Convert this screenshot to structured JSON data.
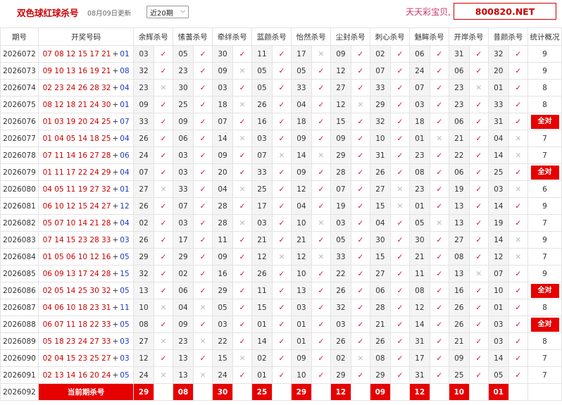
{
  "header": {
    "title": "双色球红球杀号",
    "updated": "08月09日更新",
    "period_select": "近20期",
    "slogan": "天天彩宝贝,",
    "site": "800820.NET"
  },
  "columns": [
    "期号",
    "开奖号码",
    "余辉杀号",
    "愫蓍杀号",
    "牵绊杀号",
    "蓝颜杀号",
    "怡然杀号",
    "尘封杀号",
    "刺心杀号",
    "魅眸杀号",
    "开岸杀号",
    "昔颜杀号",
    "统计概况"
  ],
  "all_right_label": "全对",
  "rows": [
    {
      "period": "2026072",
      "red": "07 08 12 15 17 21",
      "blue": "01",
      "kills": [
        [
          "03",
          "ok"
        ],
        [
          "05",
          "ok"
        ],
        [
          "30",
          "ok"
        ],
        [
          "11",
          "ok"
        ],
        [
          "17",
          "bad"
        ],
        [
          "09",
          "ok"
        ],
        [
          "02",
          "ok"
        ],
        [
          "06",
          "ok"
        ],
        [
          "31",
          "ok"
        ],
        [
          "32",
          "ok"
        ]
      ],
      "count": "9"
    },
    {
      "period": "2026073",
      "red": "09 10 13 16 19 21",
      "blue": "08",
      "kills": [
        [
          "32",
          "ok"
        ],
        [
          "23",
          "ok"
        ],
        [
          "09",
          "bad"
        ],
        [
          "05",
          "ok"
        ],
        [
          "05",
          "ok"
        ],
        [
          "12",
          "ok"
        ],
        [
          "07",
          "ok"
        ],
        [
          "24",
          "ok"
        ],
        [
          "06",
          "ok"
        ],
        [
          "20",
          "ok"
        ]
      ],
      "count": "9"
    },
    {
      "period": "2026074",
      "red": "02 23 24 26 28 32",
      "blue": "04",
      "kills": [
        [
          "23",
          "bad"
        ],
        [
          "30",
          "ok"
        ],
        [
          "03",
          "ok"
        ],
        [
          "05",
          "ok"
        ],
        [
          "33",
          "ok"
        ],
        [
          "27",
          "ok"
        ],
        [
          "33",
          "ok"
        ],
        [
          "07",
          "ok"
        ],
        [
          "23",
          "bad"
        ],
        [
          "01",
          "ok"
        ]
      ],
      "count": "8"
    },
    {
      "period": "2026075",
      "red": "08 12 18 21 24 30",
      "blue": "01",
      "kills": [
        [
          "09",
          "ok"
        ],
        [
          "25",
          "ok"
        ],
        [
          "18",
          "bad"
        ],
        [
          "26",
          "ok"
        ],
        [
          "04",
          "ok"
        ],
        [
          "12",
          "bad"
        ],
        [
          "29",
          "ok"
        ],
        [
          "03",
          "ok"
        ],
        [
          "23",
          "ok"
        ],
        [
          "33",
          "ok"
        ]
      ],
      "count": "8"
    },
    {
      "period": "2026076",
      "red": "01 03 19 20 24 25",
      "blue": "07",
      "kills": [
        [
          "33",
          "ok"
        ],
        [
          "09",
          "ok"
        ],
        [
          "07",
          "ok"
        ],
        [
          "16",
          "ok"
        ],
        [
          "18",
          "ok"
        ],
        [
          "15",
          "ok"
        ],
        [
          "32",
          "ok"
        ],
        [
          "18",
          "ok"
        ],
        [
          "06",
          "ok"
        ],
        [
          "31",
          "ok"
        ]
      ],
      "count": "全对"
    },
    {
      "period": "2026077",
      "red": "01 04 05 14 18 25",
      "blue": "04",
      "kills": [
        [
          "26",
          "ok"
        ],
        [
          "06",
          "ok"
        ],
        [
          "14",
          "bad"
        ],
        [
          "03",
          "ok"
        ],
        [
          "09",
          "ok"
        ],
        [
          "09",
          "ok"
        ],
        [
          "10",
          "ok"
        ],
        [
          "01",
          "bad"
        ],
        [
          "21",
          "ok"
        ],
        [
          "04",
          "bad"
        ]
      ],
      "count": "7"
    },
    {
      "period": "2026078",
      "red": "07 11 14 16 27 28",
      "blue": "06",
      "kills": [
        [
          "24",
          "ok"
        ],
        [
          "03",
          "ok"
        ],
        [
          "09",
          "ok"
        ],
        [
          "07",
          "bad"
        ],
        [
          "14",
          "bad"
        ],
        [
          "29",
          "ok"
        ],
        [
          "31",
          "ok"
        ],
        [
          "23",
          "ok"
        ],
        [
          "22",
          "ok"
        ],
        [
          "14",
          "bad"
        ]
      ],
      "count": "7"
    },
    {
      "period": "2026079",
      "red": "01 11 17 22 24 29",
      "blue": "04",
      "kills": [
        [
          "07",
          "ok"
        ],
        [
          "03",
          "ok"
        ],
        [
          "20",
          "ok"
        ],
        [
          "33",
          "ok"
        ],
        [
          "09",
          "ok"
        ],
        [
          "28",
          "ok"
        ],
        [
          "26",
          "ok"
        ],
        [
          "08",
          "ok"
        ],
        [
          "06",
          "ok"
        ],
        [
          "25",
          "ok"
        ]
      ],
      "count": "全对"
    },
    {
      "period": "2026080",
      "red": "04 05 11 19 27 32",
      "blue": "01",
      "kills": [
        [
          "27",
          "bad"
        ],
        [
          "33",
          "ok"
        ],
        [
          "04",
          "bad"
        ],
        [
          "25",
          "ok"
        ],
        [
          "12",
          "ok"
        ],
        [
          "07",
          "ok"
        ],
        [
          "27",
          "bad"
        ],
        [
          "23",
          "ok"
        ],
        [
          "19",
          "ok"
        ],
        [
          "03",
          "bad"
        ]
      ],
      "count": "6"
    },
    {
      "period": "2026081",
      "red": "06 10 12 15 24 27",
      "blue": "12",
      "kills": [
        [
          "26",
          "ok"
        ],
        [
          "07",
          "ok"
        ],
        [
          "28",
          "ok"
        ],
        [
          "17",
          "ok"
        ],
        [
          "04",
          "ok"
        ],
        [
          "19",
          "ok"
        ],
        [
          "15",
          "bad"
        ],
        [
          "01",
          "ok"
        ],
        [
          "13",
          "ok"
        ],
        [
          "14",
          "ok"
        ]
      ],
      "count": "9"
    },
    {
      "period": "2026082",
      "red": "05 07 10 14 21 28",
      "blue": "04",
      "kills": [
        [
          "02",
          "ok"
        ],
        [
          "03",
          "ok"
        ],
        [
          "28",
          "bad"
        ],
        [
          "03",
          "ok"
        ],
        [
          "10",
          "bad"
        ],
        [
          "03",
          "ok"
        ],
        [
          "04",
          "ok"
        ],
        [
          "05",
          "bad"
        ],
        [
          "13",
          "ok"
        ],
        [
          "19",
          "ok"
        ]
      ],
      "count": "7"
    },
    {
      "period": "2026083",
      "red": "07 14 15 23 28 33",
      "blue": "03",
      "kills": [
        [
          "26",
          "ok"
        ],
        [
          "17",
          "ok"
        ],
        [
          "11",
          "ok"
        ],
        [
          "21",
          "ok"
        ],
        [
          "21",
          "ok"
        ],
        [
          "05",
          "ok"
        ],
        [
          "30",
          "ok"
        ],
        [
          "30",
          "ok"
        ],
        [
          "27",
          "ok"
        ],
        [
          "14",
          "bad"
        ]
      ],
      "count": "9"
    },
    {
      "period": "2026084",
      "red": "01 05 06 10 12 16",
      "blue": "05",
      "kills": [
        [
          "29",
          "ok"
        ],
        [
          "29",
          "ok"
        ],
        [
          "09",
          "ok"
        ],
        [
          "12",
          "bad"
        ],
        [
          "12",
          "bad"
        ],
        [
          "33",
          "ok"
        ],
        [
          "15",
          "ok"
        ],
        [
          "21",
          "ok"
        ],
        [
          "08",
          "ok"
        ],
        [
          "12",
          "bad"
        ]
      ],
      "count": "7"
    },
    {
      "period": "2026085",
      "red": "06 09 13 17 24 28",
      "blue": "15",
      "kills": [
        [
          "32",
          "ok"
        ],
        [
          "02",
          "ok"
        ],
        [
          "16",
          "ok"
        ],
        [
          "26",
          "ok"
        ],
        [
          "10",
          "ok"
        ],
        [
          "22",
          "ok"
        ],
        [
          "27",
          "ok"
        ],
        [
          "11",
          "ok"
        ],
        [
          "13",
          "bad"
        ],
        [
          "07",
          "ok"
        ]
      ],
      "count": "9"
    },
    {
      "period": "2026086",
      "red": "02 05 14 25 30 32",
      "blue": "05",
      "kills": [
        [
          "13",
          "ok"
        ],
        [
          "06",
          "ok"
        ],
        [
          "29",
          "ok"
        ],
        [
          "11",
          "ok"
        ],
        [
          "13",
          "ok"
        ],
        [
          "26",
          "ok"
        ],
        [
          "06",
          "ok"
        ],
        [
          "08",
          "ok"
        ],
        [
          "16",
          "ok"
        ],
        [
          "10",
          "ok"
        ]
      ],
      "count": "全对"
    },
    {
      "period": "2026087",
      "red": "04 06 10 18 23 31",
      "blue": "11",
      "kills": [
        [
          "10",
          "bad"
        ],
        [
          "04",
          "bad"
        ],
        [
          "05",
          "ok"
        ],
        [
          "15",
          "ok"
        ],
        [
          "03",
          "ok"
        ],
        [
          "32",
          "ok"
        ],
        [
          "28",
          "ok"
        ],
        [
          "12",
          "ok"
        ],
        [
          "26",
          "ok"
        ],
        [
          "01",
          "ok"
        ]
      ],
      "count": "8"
    },
    {
      "period": "2026088",
      "red": "06 07 11 18 22 33",
      "blue": "05",
      "kills": [
        [
          "08",
          "ok"
        ],
        [
          "09",
          "ok"
        ],
        [
          "03",
          "ok"
        ],
        [
          "01",
          "ok"
        ],
        [
          "01",
          "ok"
        ],
        [
          "03",
          "ok"
        ],
        [
          "21",
          "ok"
        ],
        [
          "14",
          "ok"
        ],
        [
          "26",
          "ok"
        ],
        [
          "03",
          "ok"
        ]
      ],
      "count": "全对"
    },
    {
      "period": "2026089",
      "red": "05 18 23 24 27 33",
      "blue": "03",
      "kills": [
        [
          "27",
          "bad"
        ],
        [
          "23",
          "bad"
        ],
        [
          "22",
          "ok"
        ],
        [
          "14",
          "ok"
        ],
        [
          "01",
          "ok"
        ],
        [
          "26",
          "ok"
        ],
        [
          "26",
          "ok"
        ],
        [
          "31",
          "ok"
        ],
        [
          "21",
          "ok"
        ],
        [
          "03",
          "ok"
        ]
      ],
      "count": "8"
    },
    {
      "period": "2026090",
      "red": "02 04 15 23 25 27",
      "blue": "03",
      "kills": [
        [
          "12",
          "ok"
        ],
        [
          "13",
          "ok"
        ],
        [
          "15",
          "bad"
        ],
        [
          "02",
          "ok"
        ],
        [
          "09",
          "ok"
        ],
        [
          "02",
          "bad"
        ],
        [
          "08",
          "ok"
        ],
        [
          "17",
          "ok"
        ],
        [
          "09",
          "ok"
        ],
        [
          "14",
          "ok"
        ]
      ],
      "count": "7"
    },
    {
      "period": "2026091",
      "red": "02 13 14 16 20 24",
      "blue": "05",
      "kills": [
        [
          "24",
          "bad"
        ],
        [
          "13",
          "bad"
        ],
        [
          "24",
          "ok"
        ],
        [
          "01",
          "ok"
        ],
        [
          "10",
          "ok"
        ],
        [
          "29",
          "ok"
        ],
        [
          "29",
          "ok"
        ],
        [
          "31",
          "ok"
        ],
        [
          "25",
          "ok"
        ],
        [
          "05",
          "ok"
        ]
      ],
      "count": "7"
    }
  ],
  "current": {
    "period": "2026092",
    "label": "当前期杀号",
    "picks": [
      "29",
      "08",
      "30",
      "25",
      "29",
      "12",
      "09",
      "12",
      "10",
      "01"
    ]
  },
  "colors": {
    "accent_red": "#e60000",
    "check_red": "#cc1133",
    "cross_gray": "#bbbbbb",
    "blue_ball": "#1a3cbf"
  }
}
